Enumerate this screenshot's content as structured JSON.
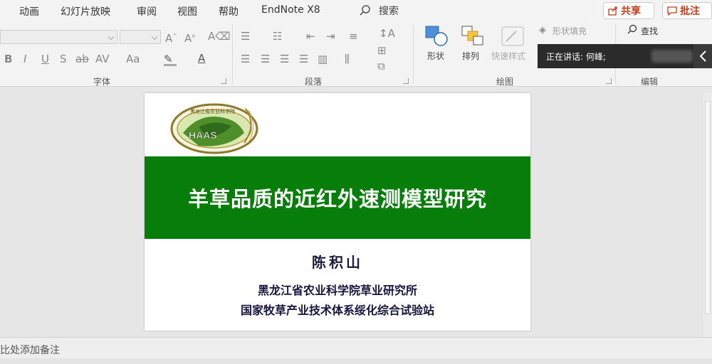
{
  "menu": {
    "items": [
      "动画",
      "幻灯片放映",
      "审阅",
      "视图",
      "帮助",
      "EndNote X8"
    ],
    "search_label": "搜索",
    "share_label": "共享",
    "comment_label": "批注"
  },
  "ribbon": {
    "groups": {
      "font": "字体",
      "paragraph": "段落",
      "drawing": "绘图",
      "editing": "编辑"
    },
    "drawing": {
      "shapes": "形状",
      "arrange": "排列",
      "quick_styles": "快速样式",
      "shape_fill": "形状填充"
    },
    "editing": {
      "find": "查找"
    }
  },
  "speaking": {
    "text": "正在讲话: 何峰;"
  },
  "slide": {
    "logo_text": "HAAS",
    "logo_ring_text": "黑龙江省农业科学院",
    "title": "羊草品质的近红外速测模型研究",
    "author": "陈积山",
    "affiliation_1": "黑龙江省农业科学院草业研究所",
    "affiliation_2": "国家牧草产业技术体系绥化综合试验站"
  },
  "notes": {
    "placeholder": "比处添加备注"
  },
  "colors": {
    "title_band": "#077d0a",
    "accent": "#c43e1c"
  }
}
